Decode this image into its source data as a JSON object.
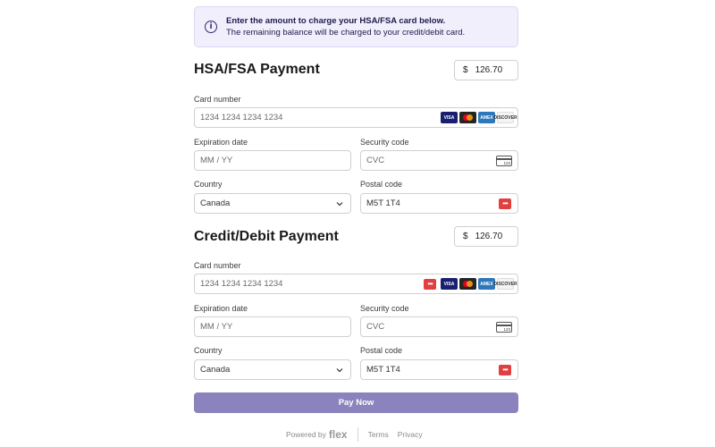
{
  "banner": {
    "line1": "Enter the amount to charge your HSA/FSA card below.",
    "line2": "The remaining balance will be charged to your credit/debit card."
  },
  "hsa": {
    "title": "HSA/FSA Payment",
    "currency": "$",
    "amount": "126.70",
    "card_label": "Card number",
    "card_placeholder": "1234 1234 1234 1234",
    "exp_label": "Expiration date",
    "exp_placeholder": "MM / YY",
    "cvc_label": "Security code",
    "cvc_placeholder": "CVC",
    "country_label": "Country",
    "country_value": "Canada",
    "postal_label": "Postal code",
    "postal_value": "M5T 1T4"
  },
  "credit": {
    "title": "Credit/Debit Payment",
    "currency": "$",
    "amount": "126.70",
    "card_label": "Card number",
    "card_placeholder": "1234 1234 1234 1234",
    "exp_label": "Expiration date",
    "exp_placeholder": "MM / YY",
    "cvc_label": "Security code",
    "cvc_placeholder": "CVC",
    "country_label": "Country",
    "country_value": "Canada",
    "postal_label": "Postal code",
    "postal_value": "M5T 1T4"
  },
  "brands": [
    "VISA",
    "",
    "AMEX",
    "DISCOVER"
  ],
  "cvc_icon_text": "123",
  "pay_button": "Pay Now",
  "footer": {
    "powered_by": "Powered by",
    "logo": "flex",
    "terms": "Terms",
    "privacy": "Privacy"
  },
  "colors": {
    "accent": "#8a83bd",
    "banner_bg": "#f1effc",
    "link_icon": "#e04040"
  }
}
